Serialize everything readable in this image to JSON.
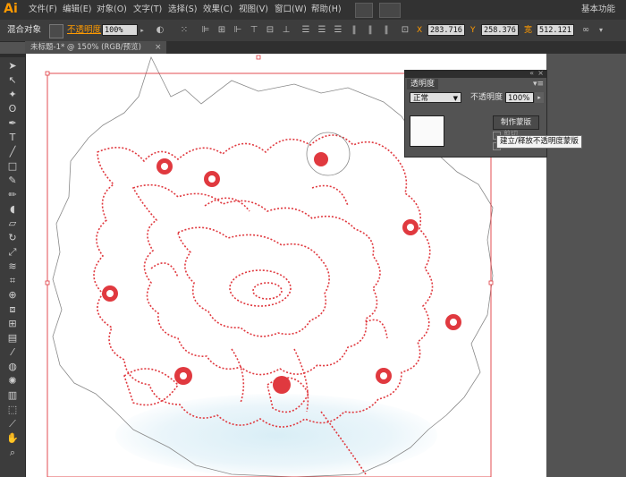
{
  "app": {
    "logo": "Ai"
  },
  "menu": {
    "items": [
      "文件(F)",
      "编辑(E)",
      "对象(O)",
      "文字(T)",
      "选择(S)",
      "效果(C)",
      "视图(V)",
      "窗口(W)",
      "帮助(H)"
    ],
    "workspace": "基本功能"
  },
  "control_bar": {
    "object_label": "混合对象",
    "opacity_label": "不透明度",
    "opacity_value": "100%",
    "x_value": "283.716",
    "y_value": "258.376",
    "w_value": "512.121"
  },
  "document": {
    "tab_title": "未标题-1* @ 150% (RGB/预览)",
    "close_glyph": "×"
  },
  "transparency_panel": {
    "title": "透明度",
    "blend_mode": "正常",
    "opacity_label": "不透明度",
    "opacity_value": "100%",
    "make_mask_button": "制作蒙版",
    "clip_label": "剪切",
    "invert_label": "反",
    "tooltip": "建立/释放不透明度蒙版"
  },
  "tools": [
    "selection-tool-icon",
    "direct-selection-tool-icon",
    "magic-wand-tool-icon",
    "lasso-tool-icon",
    "pen-tool-icon",
    "type-tool-icon",
    "line-tool-icon",
    "rectangle-tool-icon",
    "paintbrush-tool-icon",
    "pencil-tool-icon",
    "blob-brush-tool-icon",
    "eraser-tool-icon",
    "rotate-tool-icon",
    "scale-tool-icon",
    "width-tool-icon",
    "free-transform-tool-icon",
    "shape-builder-tool-icon",
    "perspective-grid-tool-icon",
    "mesh-tool-icon",
    "gradient-tool-icon",
    "eyedropper-tool-icon",
    "blend-tool-icon",
    "symbol-sprayer-tool-icon",
    "column-graph-tool-icon",
    "artboard-tool-icon",
    "slice-tool-icon",
    "hand-tool-icon",
    "zoom-tool-icon"
  ],
  "colors": {
    "accent": "#ff9a00",
    "path": "#e0393f",
    "ui_dark": "#323232",
    "ui_mid": "#535353"
  }
}
